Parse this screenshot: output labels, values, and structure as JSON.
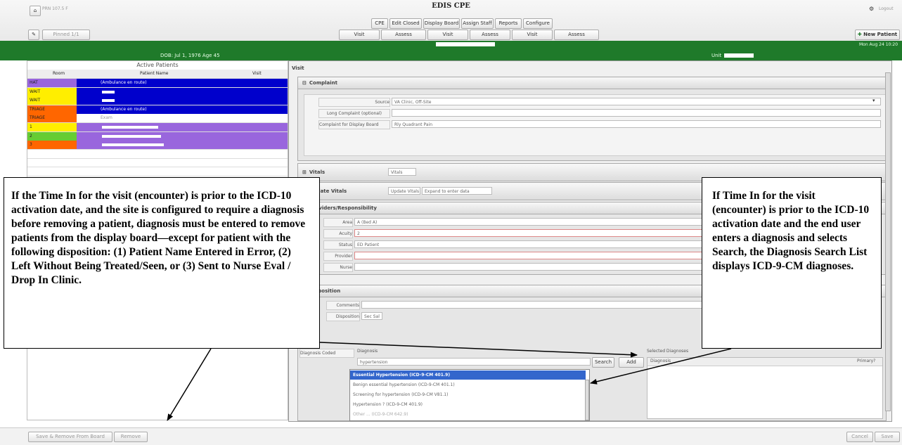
{
  "app_title": "EDIS CPE",
  "header": {
    "user_info": "PRN 107.5 F",
    "logout_label": "Logout",
    "pinned_label": "Pinned 1/1",
    "new_patient_label": "New Patient",
    "timestamp": "Mon Aug 24 10:20"
  },
  "main_tabs": [
    "CPE",
    "Edit Closed",
    "Display Board",
    "Assign Staff",
    "Reports",
    "Configure"
  ],
  "sub_tabs": [
    "Visit",
    "Assess",
    "Visit",
    "Assess",
    "Visit",
    "Assess"
  ],
  "patient_banner": {
    "center_text": "DOB: Jul 1, 1976  Age 45",
    "right_label": "Unit"
  },
  "active_patients": {
    "title": "Active Patients",
    "columns": [
      "Room",
      "Patient Name",
      "Visit"
    ],
    "rows": [
      {
        "room": "HAT",
        "name": "(Ambulance en route)",
        "room_color": "#9966dd",
        "name_color": "#0000cc"
      },
      {
        "room": "WAIT",
        "name": "",
        "room_color": "#ffee00",
        "name_color": "#0000cc"
      },
      {
        "room": "WAIT",
        "name": "",
        "room_color": "#ffee00",
        "name_color": "#0000cc"
      },
      {
        "room": "TRIAGE",
        "name": "(Ambulance en route)",
        "room_color": "#ff6600",
        "name_color": "#0000cc"
      },
      {
        "room": "TRIAGE",
        "name": "Exam",
        "room_color": "#ff6600",
        "name_color": "#ffffff"
      },
      {
        "room": "1",
        "name": "",
        "room_color": "#ffee00",
        "name_color": "#9966dd"
      },
      {
        "room": "2",
        "name": "",
        "room_color": "#66cc33",
        "name_color": "#9966dd"
      },
      {
        "room": "3",
        "name": "",
        "room_color": "#ff6600",
        "name_color": "#9966dd"
      }
    ]
  },
  "visit": {
    "title": "Visit",
    "complaint": {
      "header": "Complaint",
      "source_label": "Source",
      "source_value": "VA Clinic, Off-Site",
      "long_label": "Long Complaint (optional)",
      "display_label": "Complaint for Display Board",
      "display_value": "Rly Quadrant Pain"
    },
    "vitals": {
      "header": "Vitals",
      "vitals_label": "Vitals"
    },
    "update_vitals": {
      "header": "Update Vitals",
      "update_label": "Update Vitals",
      "expand_label": "Expand to enter data"
    },
    "provider": {
      "header": "Providers/Responsibility",
      "area_label": "Area",
      "area_value": "A (Bed A)",
      "acuity_label": "Acuity",
      "acuity_value": "2",
      "status_label": "Status",
      "status_value": "ED Patient",
      "provider_label": "Provider",
      "nurse_label": "Nurse"
    },
    "disposition": {
      "header": "Disposition",
      "comments_label": "Comments",
      "disposition_label": "Disposition",
      "disposition_value": "Sec Sal",
      "diagnosis_label": "Diagnosis Coded",
      "diagnosis_col": "Diagnosis",
      "diagnosis_value": "hypertension",
      "search_label": "Search",
      "add_label": "Add",
      "selected_label": "Selected Diagnoses",
      "diag_col": "Diagnosis",
      "primary_col": "Primary?"
    }
  },
  "diagnosis_list": [
    "Essential Hypertension (ICD-9-CM 401.9)",
    "Benign essential hypertension (ICD-9-CM 401.1)",
    "Screening for hypertension (ICD-9-CM V81.1)",
    "Hypertension ? (ICD-9-CM 401.9)",
    "Other ... (ICD-9-CM 642.9)"
  ],
  "callouts": {
    "left": "If the Time In for the visit (encounter) is prior to the ICD-10 activation date, and the site is configured to require a diagnosis before removing a patient, diagnosis must be entered to remove patients from the display board—except for patient with the following disposition: (1) Patient Name Entered in Error, (2) Left Without Being Treated/Seen, or (3) Sent to Nurse Eval / Drop In Clinic.",
    "right": "If Time In for the visit (encounter) is prior to the ICD-10 activation date and the end user enters a diagnosis and selects Search, the Diagnosis Search List displays ICD-9-CM diagnoses."
  },
  "footer": {
    "remove_label": "Save & Remove From Board",
    "remove2_label": "Remove",
    "cancel_label": "Cancel",
    "save_label": "Save"
  },
  "colors": {
    "green_banner": "#1f7a2a",
    "selected_row": "#3366cc"
  }
}
